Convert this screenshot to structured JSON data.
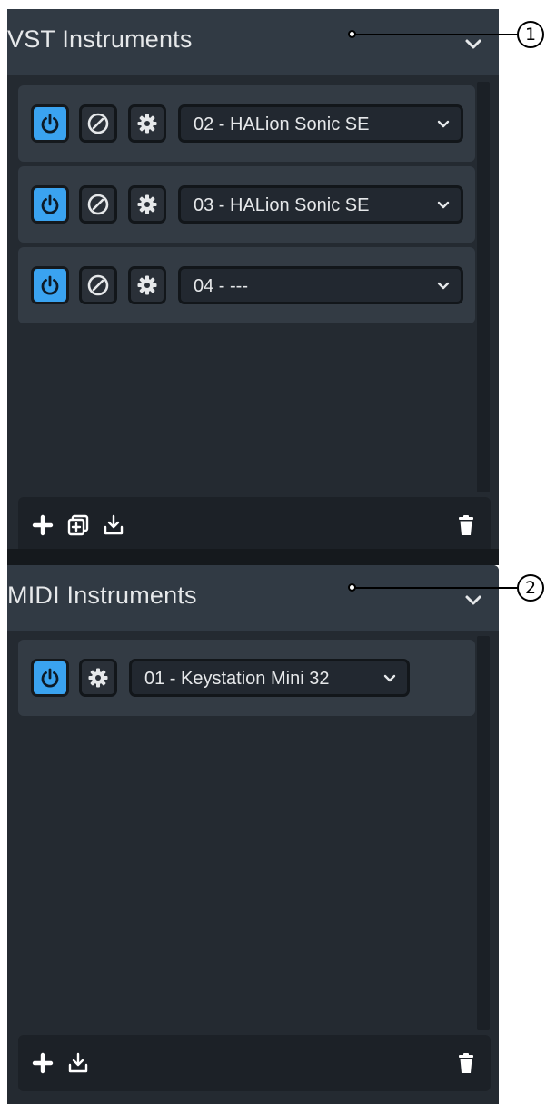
{
  "vst_panel": {
    "title": "VST Instruments",
    "slots": [
      {
        "label": "02 - HALion Sonic SE",
        "power_on": true
      },
      {
        "label": "03 - HALion Sonic SE",
        "power_on": true
      },
      {
        "label": "04 - ---",
        "power_on": true
      }
    ],
    "toolbar": [
      "add-icon",
      "duplicate-icon",
      "import-icon",
      "trash-icon"
    ]
  },
  "midi_panel": {
    "title": "MIDI Instruments",
    "slots": [
      {
        "label": "01 - Keystation Mini 32",
        "power_on": true
      }
    ],
    "toolbar": [
      "add-icon",
      "import-icon",
      "trash-icon"
    ]
  },
  "callouts": [
    "1",
    "2"
  ],
  "colors": {
    "panel_bg": "#242a31",
    "header_bg": "#313a44",
    "slot_bg": "#333b44",
    "power_active": "#3aa3f0",
    "text": "#e6e8ea"
  }
}
